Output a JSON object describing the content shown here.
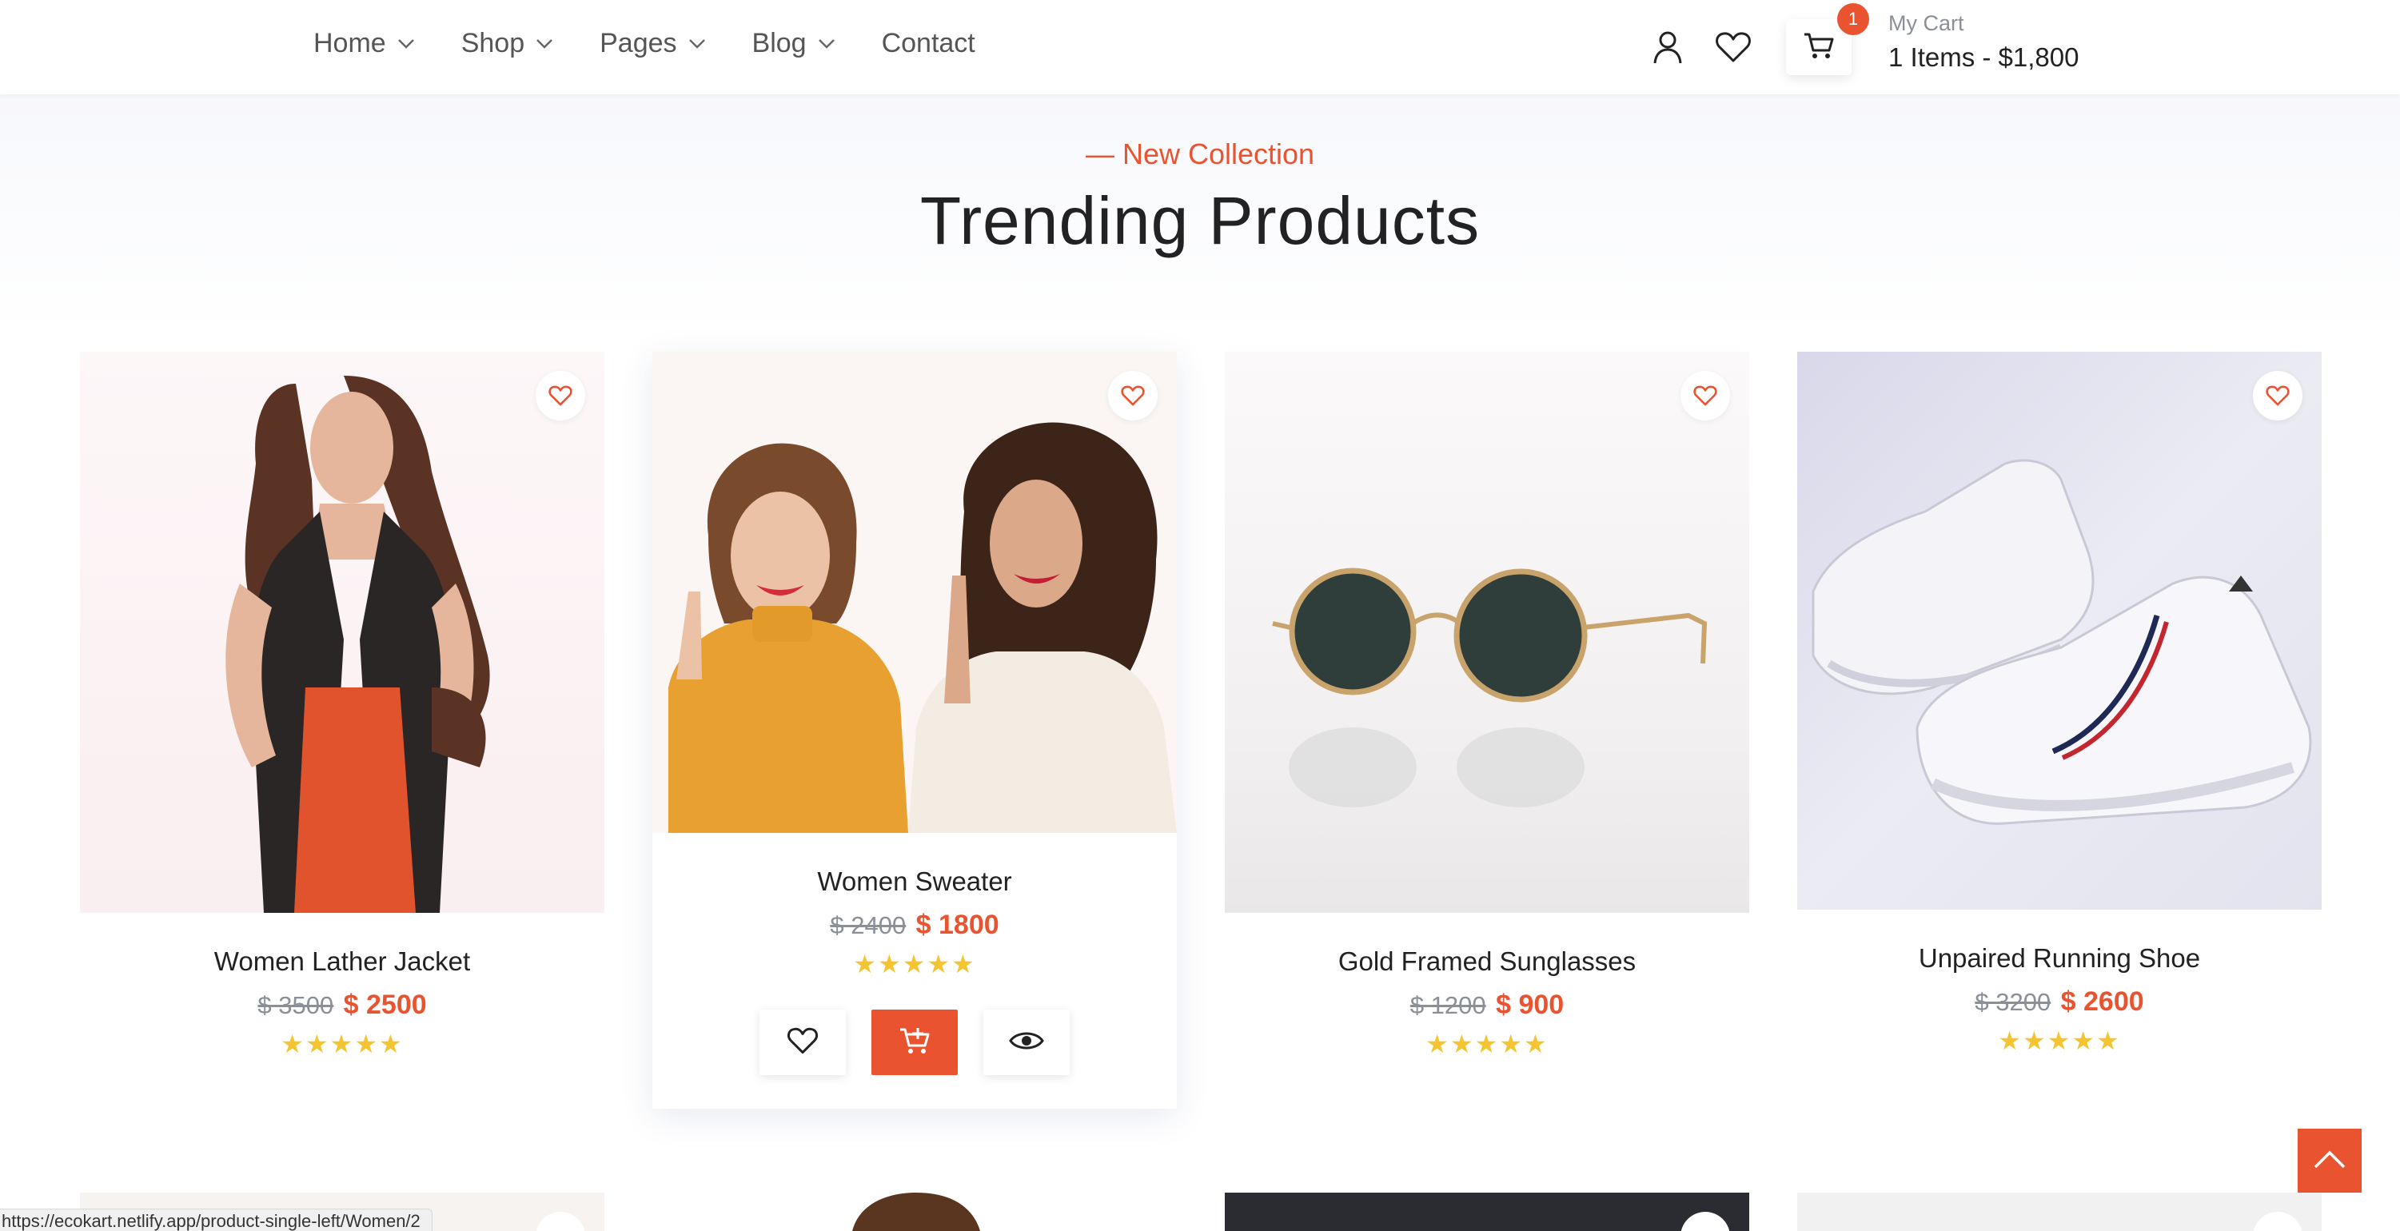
{
  "nav": {
    "items": [
      {
        "label": "Home",
        "has_dropdown": true
      },
      {
        "label": "Shop",
        "has_dropdown": true
      },
      {
        "label": "Pages",
        "has_dropdown": true
      },
      {
        "label": "Blog",
        "has_dropdown": true
      },
      {
        "label": "Contact",
        "has_dropdown": false
      }
    ]
  },
  "header": {
    "icons": [
      "user-icon",
      "heart-icon",
      "cart-icon"
    ],
    "cart_badge": "1",
    "cart_label": "My Cart",
    "cart_summary": "1 Items - $1,800"
  },
  "section": {
    "eyebrow": "— New Collection",
    "title": "Trending Products"
  },
  "products": [
    {
      "name": "Women Lather Jacket",
      "old_price": "$ 3500",
      "price": "$ 2500",
      "stars": "★★★★★",
      "rating": 5
    },
    {
      "name": "Women Sweater",
      "old_price": "$ 2400",
      "price": "$ 1800",
      "stars": "★★★★★",
      "rating": 5
    },
    {
      "name": "Gold Framed Sunglasses",
      "old_price": "$ 1200",
      "price": "$ 900",
      "stars": "★★★★★",
      "rating": 5
    },
    {
      "name": "Unpaired Running Shoe",
      "old_price": "$ 3200",
      "price": "$ 2600",
      "stars": "★★★★★",
      "rating": 5
    }
  ],
  "card_actions": [
    "heart-icon",
    "add-to-cart-icon",
    "eye-icon"
  ],
  "status_bar": {
    "url": "https://ecokart.netlify.app/product-single-left/Women/2"
  },
  "colors": {
    "accent": "#e95330",
    "star": "#f5c531",
    "muted": "#8b8f98"
  }
}
